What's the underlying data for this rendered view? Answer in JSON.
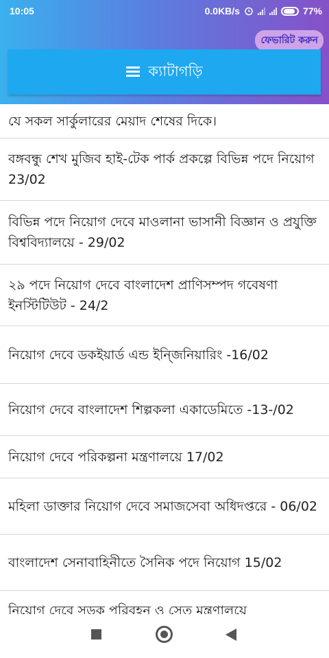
{
  "status_bar": {
    "time": "10:05",
    "speed": "0.0KB/s",
    "battery": "77%",
    "icons": [
      "alarm-icon",
      "signal-icon",
      "signal-icon",
      "battery-icon"
    ]
  },
  "favorite_button": {
    "label": "ফেভারিট করুন"
  },
  "category_bar": {
    "label": "ক্যাটাগড়ি",
    "icon": "menu-icon"
  },
  "list": {
    "items": [
      {
        "text": "যে সকল সার্কুলারের মেয়াদ শেষের দিকে।"
      },
      {
        "text": "বঙ্গবন্ধু শেখ মুজিব হাই-টেক পার্ক প্রকল্পে বিভিন্ন পদে নিয়োগ 23/02"
      },
      {
        "text": "বিভিন্ন পদে নিয়োগ দেবে মাওলানা ভাসানী বিজ্ঞান ও প্রযুক্তি বিশ্ববিদ্যালয়ে - 29/02"
      },
      {
        "text": "২৯ পদে নিয়োগ দেবে বাংলাদেশ প্রাণিসম্পদ গবেষণা ইনস্টিটিউট - 24/2"
      },
      {
        "text": "নিয়োগ দেবে ডকইয়ার্ড এন্ড ইন্জিনিয়ারিং -16/02"
      },
      {
        "text": "নিয়োগ দেবে বাংলাদেশ শিল্পকলা একাডেমিতে -13-/02"
      },
      {
        "text": "নিয়োগ দেবে পরিকল্পনা মন্ত্রণালয়ে 17/02"
      },
      {
        "text": "মহিলা ডাক্তার নিয়োগ দেবে সমাজসেবা অধিদপ্তরে - 06/02"
      },
      {
        "text": "বাংলাদেশ সেনাবাহিনীতে সৈনিক পদে নিয়োগ 15/02"
      },
      {
        "text": "নিয়োগ দেবে সড়ক পরিবহন ও সেতু মন্ত্রণালয়ে"
      }
    ]
  },
  "nav_bar": {
    "icons": [
      "recent-apps-icon",
      "home-icon",
      "back-icon"
    ]
  }
}
